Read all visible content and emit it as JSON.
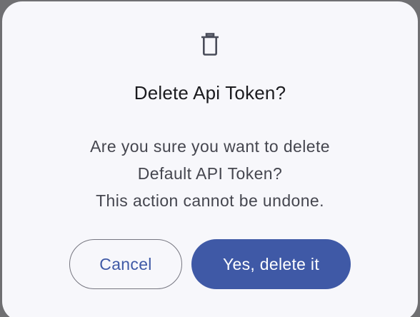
{
  "dialog": {
    "icon": "trash-icon",
    "title": "Delete Api Token?",
    "message_lines": [
      "Are you sure you want to delete",
      "Default API Token?",
      "This action cannot be undone."
    ],
    "cancel_label": "Cancel",
    "confirm_label": "Yes, delete it"
  },
  "colors": {
    "dialog_background": "#f7f7fb",
    "primary": "#3f59a6",
    "title_text": "#1b1b1f",
    "body_text": "#45464f",
    "outline": "#767680"
  }
}
